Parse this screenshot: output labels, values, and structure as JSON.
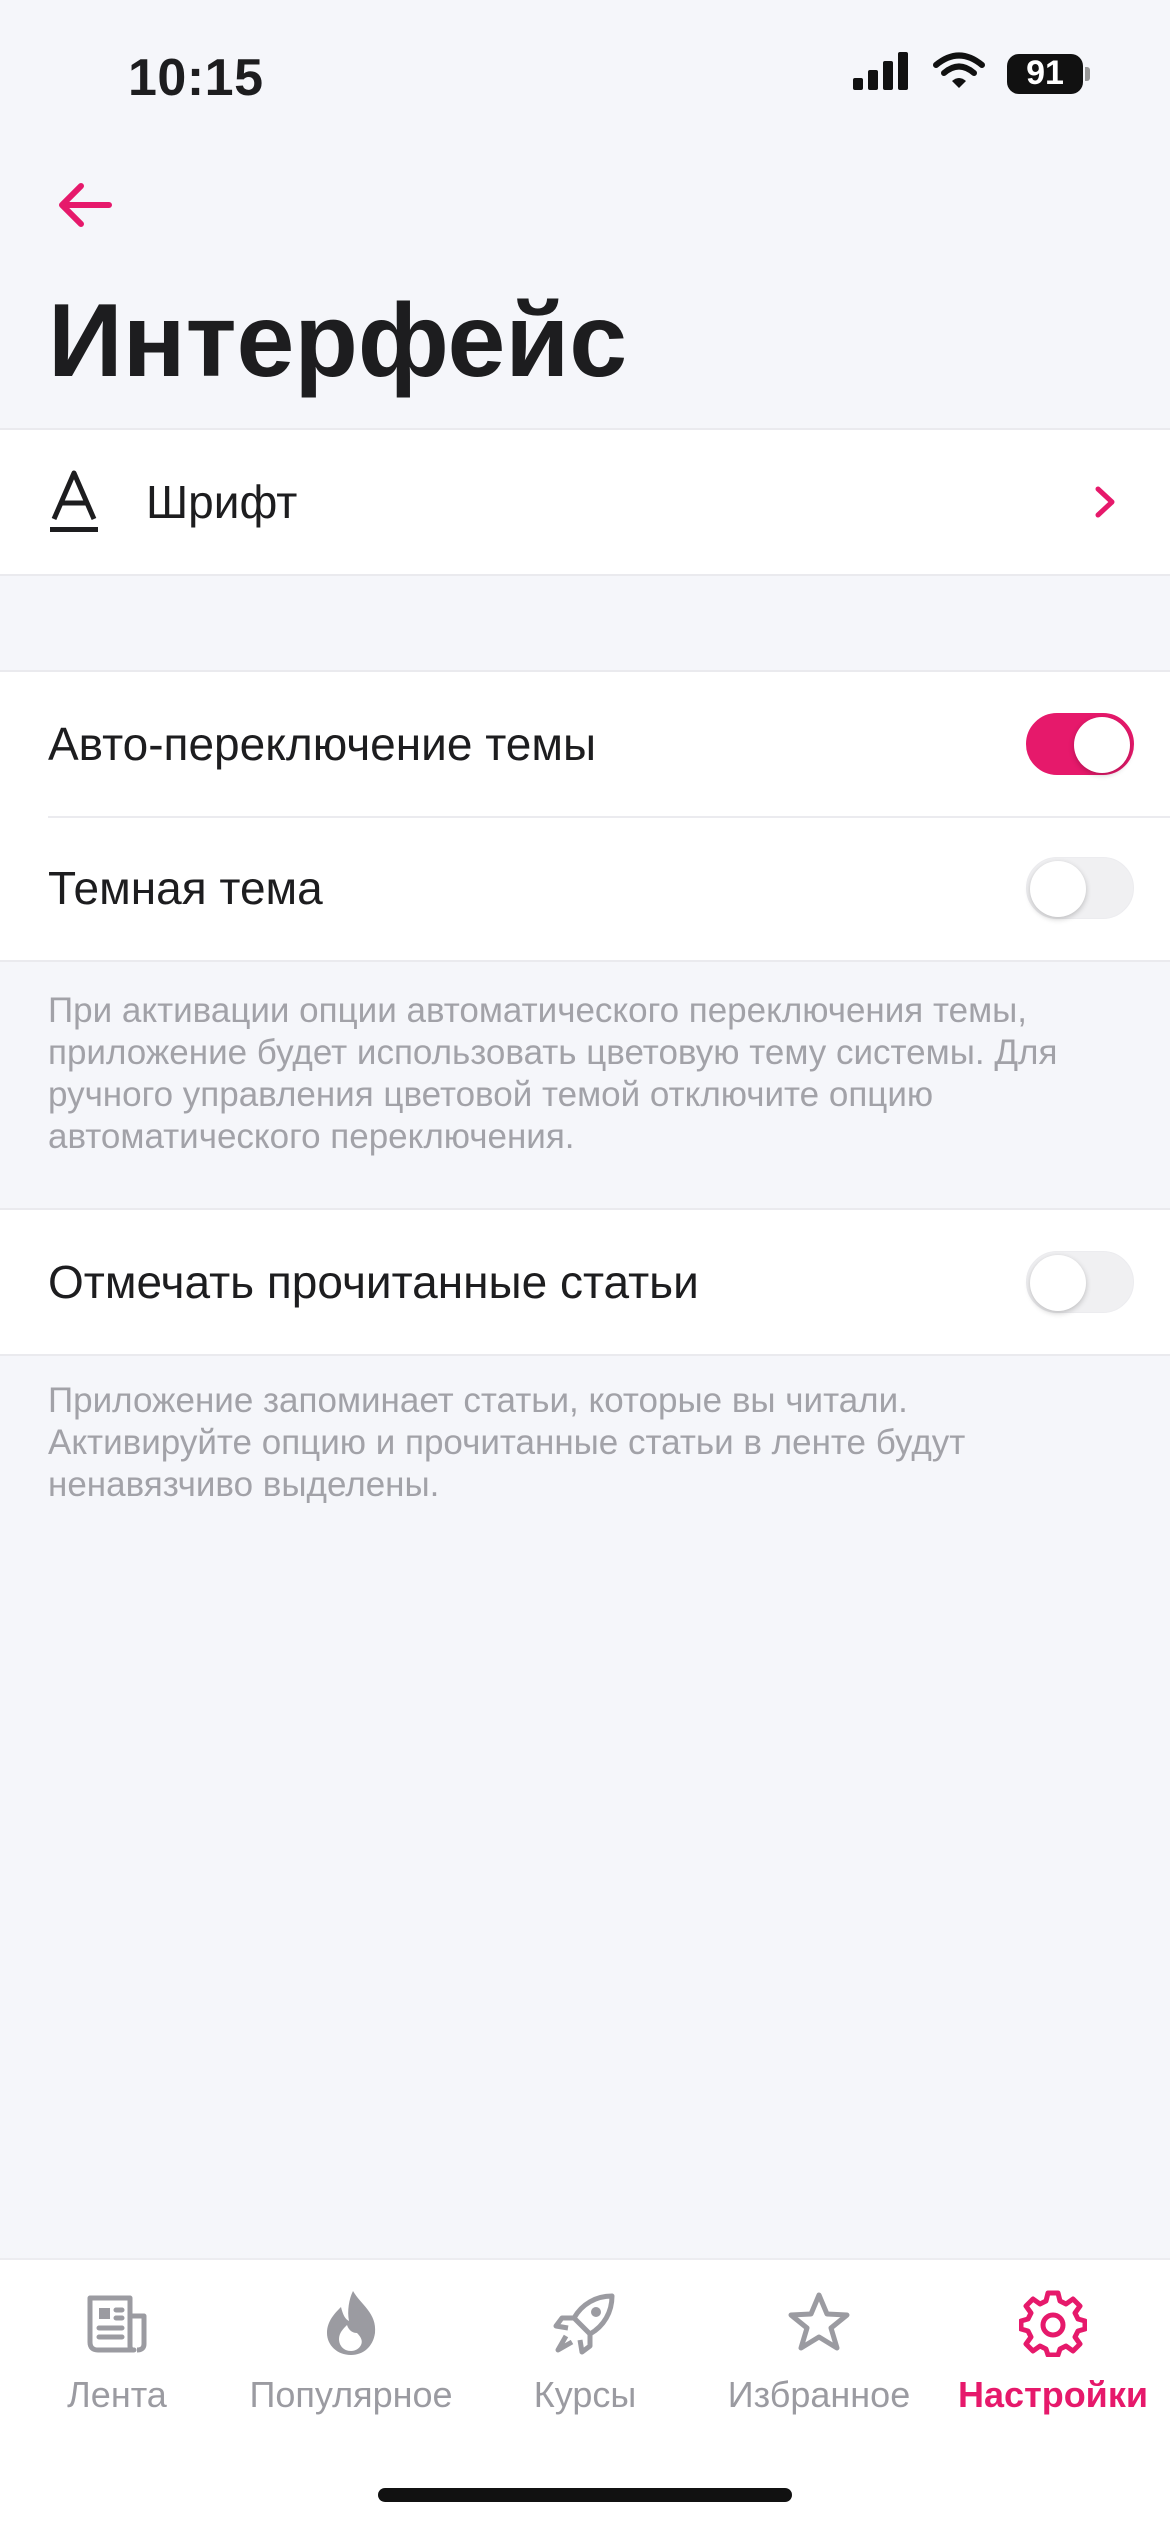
{
  "status_bar": {
    "time": "10:15",
    "battery": "91"
  },
  "header": {
    "title": "Интерфейс",
    "back_icon": "arrow-left-icon"
  },
  "font_row": {
    "label": "Шрифт",
    "icon": "font-icon"
  },
  "theme": {
    "auto_label": "Авто-переключение темы",
    "auto_on": true,
    "dark_label": "Темная тема",
    "dark_on": false,
    "description": "При активации опции автоматического переключения темы, приложение будет использовать цветовую тему системы. Для ручного управления цветовой темой отключите опцию автоматического переключения."
  },
  "read_articles": {
    "label": "Отмечать прочитанные статьи",
    "on": false,
    "description": "Приложение запоминает статьи, которые вы читали. Активируйте опцию и прочитанные статьи в ленте будут ненавязчиво выделены."
  },
  "tabs": [
    {
      "label": "Лента",
      "icon": "feed-icon",
      "active": false
    },
    {
      "label": "Популярное",
      "icon": "flame-icon",
      "active": false
    },
    {
      "label": "Курсы",
      "icon": "rocket-icon",
      "active": false
    },
    {
      "label": "Избранное",
      "icon": "star-icon",
      "active": false
    },
    {
      "label": "Настройки",
      "icon": "gear-icon",
      "active": true
    }
  ],
  "colors": {
    "accent": "#e6196b",
    "background": "#f5f6fa",
    "secondary_text": "#a2a2a8",
    "tab_inactive": "#9b9ba1"
  }
}
